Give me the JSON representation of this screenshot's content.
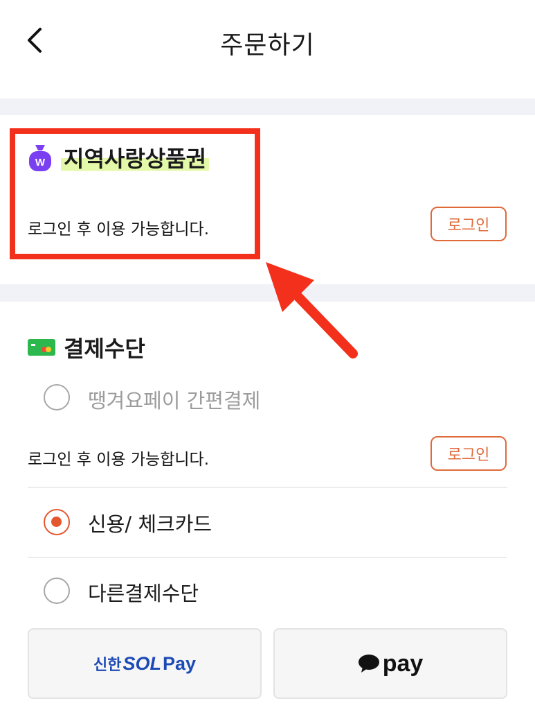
{
  "header": {
    "title": "주문하기"
  },
  "gift_voucher": {
    "title": "지역사랑상품권",
    "note": "로그인 후 이용 가능합니다.",
    "login_label": "로그인"
  },
  "payment": {
    "title": "결제수단",
    "easy_pay": {
      "label": "땡겨요페이 간편결제",
      "note": "로그인 후 이용 가능합니다.",
      "login_label": "로그인",
      "selected": false
    },
    "options": [
      {
        "label": "신용/ 체크카드",
        "selected": true
      },
      {
        "label": "다른결제수단",
        "selected": false
      }
    ],
    "quick_buttons": [
      {
        "brand_a": "신한",
        "brand_b": "SOL",
        "brand_c": "Pay",
        "color": "#1d4bb5"
      },
      {
        "brand": "pay",
        "color": "#111111"
      }
    ]
  },
  "colors": {
    "accent": "#e4572e",
    "highlight_box": "#f2301b",
    "gap": "#f1f2f7",
    "voucher_icon": "#7b3ff2",
    "card_icon": "#2db84e"
  }
}
